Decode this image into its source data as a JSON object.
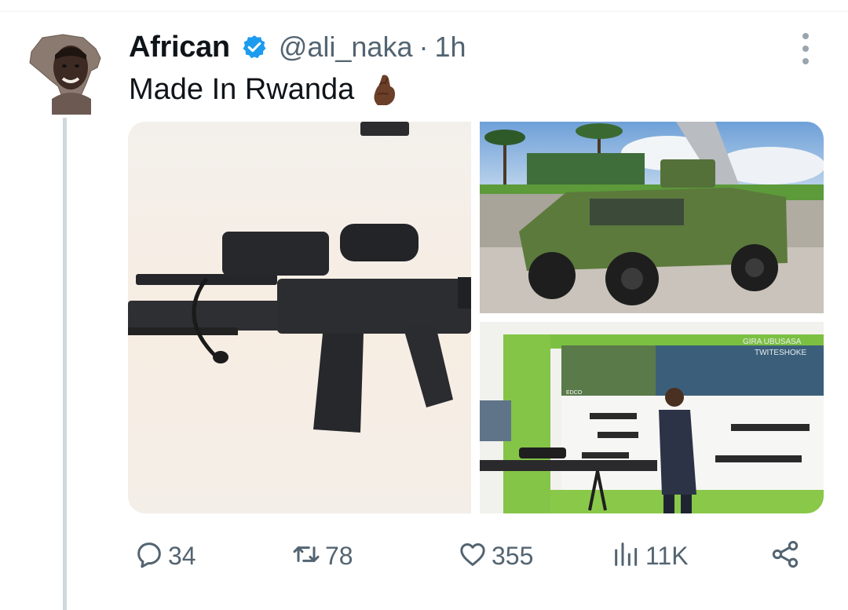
{
  "tweet": {
    "author": {
      "display_name": "African",
      "handle": "@ali_naka",
      "verified": true
    },
    "separator": "·",
    "time": "1h",
    "text": "Made In Rwanda",
    "emoji": "pinched-fingers-emoji",
    "media": [
      {
        "name": "rifle-photo"
      },
      {
        "name": "armored-vehicle-photo"
      },
      {
        "name": "weapons-exhibition-photo",
        "sign_text": [
          "GIRA UBUSASA",
          "TWITESHOKE",
          "EDCO"
        ]
      }
    ],
    "actions": {
      "replies": "34",
      "reposts": "78",
      "likes": "355",
      "views": "11K"
    }
  },
  "colors": {
    "verified": "#1d9bf0",
    "muted": "#536471",
    "thread_line": "#cfd9de"
  },
  "icons": [
    "verified-badge-icon",
    "more-icon",
    "reply-icon",
    "repost-icon",
    "like-icon",
    "views-icon",
    "share-icon"
  ]
}
